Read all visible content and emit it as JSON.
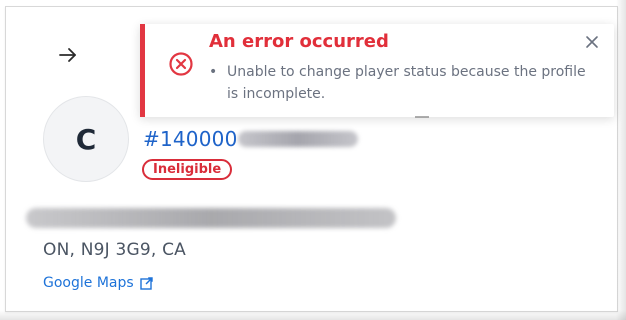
{
  "toast": {
    "title": "An error occurred",
    "message": "Unable to change player status because the profile is incomplete.",
    "bullet": "•",
    "accent": "#e23742",
    "close_icon": "close-icon",
    "status_icon": "error-x-circle-icon"
  },
  "navigation": {
    "back_icon": "arrow-right-icon"
  },
  "profile": {
    "avatar_initial": "C",
    "player_id_prefix": "#140000",
    "status_badge": "Ineligible",
    "status_color": "#d92d3a",
    "link_color": "#1e63c9"
  },
  "address": {
    "line2": "ON, N9J 3G9, CA",
    "maps_link_text": "Google Maps",
    "external_icon": "external-link-icon"
  }
}
